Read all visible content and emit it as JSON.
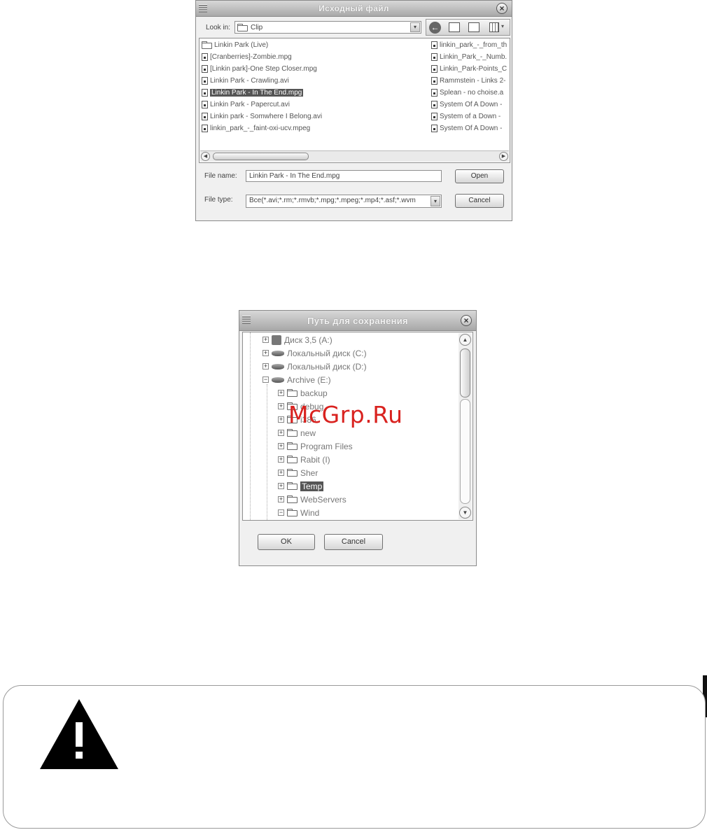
{
  "open_dialog": {
    "title": "Исходный файл",
    "look_in_label": "Look in:",
    "look_in_value": "Clip",
    "files_col1": [
      {
        "name": "Linkin Park (Live)",
        "type": "folder"
      },
      {
        "name": "[Cranberries]-Zombie.mpg",
        "type": "file"
      },
      {
        "name": "[Linkin park]-One Step Closer.mpg",
        "type": "file"
      },
      {
        "name": "Linkin Park - Crawling.avi",
        "type": "file"
      },
      {
        "name": "Linkin Park - In The End.mpg",
        "type": "file",
        "selected": true
      },
      {
        "name": "Linkin Park - Papercut.avi",
        "type": "file"
      },
      {
        "name": "Linkin park - Somwhere I Belong.avi",
        "type": "file"
      },
      {
        "name": "linkin_park_-_faint-oxi-ucv.mpeg",
        "type": "file"
      }
    ],
    "files_col2": [
      {
        "name": "linkin_park_-_from_th",
        "type": "file"
      },
      {
        "name": "Linkin_Park_-_Numb.",
        "type": "file"
      },
      {
        "name": "Linkin_Park-Points_C",
        "type": "file"
      },
      {
        "name": "Rammstein - Links 2-",
        "type": "file"
      },
      {
        "name": "Splean - no choise.a",
        "type": "file"
      },
      {
        "name": "System Of A Down -",
        "type": "file"
      },
      {
        "name": "System of a Down -",
        "type": "file"
      },
      {
        "name": "System Of A Down -",
        "type": "file"
      }
    ],
    "file_name_label": "File name:",
    "file_name_value": "Linkin Park - In The End.mpg",
    "file_type_label": "File type:",
    "file_type_value": "Все(*.avi;*.rm;*.rmvb;*.mpg;*.mpeg;*.mp4;*.asf;*.wvm",
    "open_label": "Open",
    "cancel_label": "Cancel"
  },
  "save_dialog": {
    "title": "Путь для сохранения",
    "tree": [
      {
        "label": "Диск 3,5 (A:)",
        "icon": "floppy-icon",
        "level": 0,
        "expander": "+"
      },
      {
        "label": "Локальный диск (C:)",
        "icon": "drive-icon",
        "level": 0,
        "expander": "+"
      },
      {
        "label": "Локальный диск (D:)",
        "icon": "drive-icon",
        "level": 0,
        "expander": "+"
      },
      {
        "label": "Archive (E:)",
        "icon": "drive-icon",
        "level": 0,
        "expander": "−"
      },
      {
        "label": "backup",
        "icon": "folder-icon",
        "level": 1,
        "expander": "+"
      },
      {
        "label": "debug",
        "icon": "folder-icon",
        "level": 1,
        "expander": "+"
      },
      {
        "label": "i386",
        "icon": "folder-icon",
        "level": 1,
        "expander": "+"
      },
      {
        "label": "new",
        "icon": "folder-icon",
        "level": 1,
        "expander": "+"
      },
      {
        "label": "Program Files",
        "icon": "folder-icon",
        "level": 1,
        "expander": "+"
      },
      {
        "label": "Rabit (I)",
        "icon": "folder-icon",
        "level": 1,
        "expander": "+"
      },
      {
        "label": "Sher",
        "icon": "folder-icon",
        "level": 1,
        "expander": "+"
      },
      {
        "label": "Temp",
        "icon": "folder-icon",
        "level": 1,
        "expander": "+",
        "selected": true
      },
      {
        "label": "WebServers",
        "icon": "folder-icon",
        "level": 1,
        "expander": "+"
      },
      {
        "label": "Wind",
        "icon": "folder-icon",
        "level": 1,
        "expander": "−"
      }
    ],
    "ok_label": "OK",
    "cancel_label": "Cancel"
  },
  "watermark": "McGrp.Ru",
  "warning_icon": "warning-triangle-icon"
}
